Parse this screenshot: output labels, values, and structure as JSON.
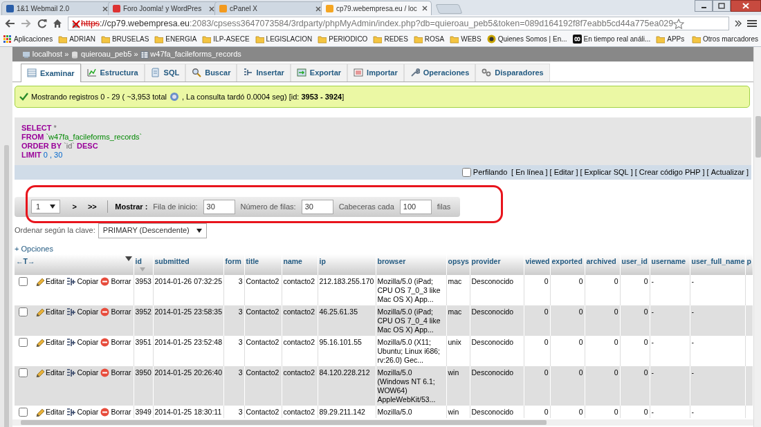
{
  "browser_tabs": [
    {
      "title": "1&1 Webmail 2.0",
      "kind": "mail",
      "selected": false
    },
    {
      "title": "Foro Joomla! y WordPres",
      "kind": "forum",
      "selected": false
    },
    {
      "title": "cPanel X",
      "kind": "cpanel",
      "selected": false
    },
    {
      "title": "cp79.webempresa.eu / loc",
      "kind": "pma",
      "selected": true
    }
  ],
  "address_bar": {
    "scheme": "https",
    "host": "://cp79.webempresa.eu",
    "path": ":2083/cpsess3647073584/3rdparty/phpMyAdmin/index.php?db=quieroau_peb5&token=089d164192f8f7eabb5cd44a775ea029"
  },
  "bookmarks": [
    {
      "label": "Aplicaciones",
      "kind": "apps"
    },
    {
      "label": "ADRIAN",
      "kind": "folder"
    },
    {
      "label": "BRUSELAS",
      "kind": "folder"
    },
    {
      "label": "ENERGIA",
      "kind": "folder"
    },
    {
      "label": "ILP-ASECE",
      "kind": "folder"
    },
    {
      "label": "LEGISLACION",
      "kind": "folder"
    },
    {
      "label": "PERIODICO",
      "kind": "folder"
    },
    {
      "label": "REDES",
      "kind": "folder"
    },
    {
      "label": "ROSA",
      "kind": "folder"
    },
    {
      "label": "WEBS",
      "kind": "folder"
    },
    {
      "label": "Quienes Somos | En...",
      "kind": "site"
    },
    {
      "label": "En tiempo real análi...",
      "kind": "infinity"
    },
    {
      "label": "APPs",
      "kind": "folder"
    }
  ],
  "other_bookmarks": "Otros marcadores",
  "breadcrumb": [
    {
      "label": "localhost",
      "kind": "server"
    },
    {
      "separator": "»",
      "label": "quieroau_peb5",
      "kind": "database"
    },
    {
      "separator": "»",
      "label": "w47fa_facileforms_records",
      "kind": "table"
    }
  ],
  "pma_tabs": [
    {
      "label": "Examinar",
      "kind": "browse",
      "selected": true
    },
    {
      "label": "Estructura",
      "kind": "structure",
      "selected": false
    },
    {
      "label": "SQL",
      "kind": "sql",
      "selected": false
    },
    {
      "label": "Buscar",
      "kind": "search",
      "selected": false
    },
    {
      "label": "Insertar",
      "kind": "insert",
      "selected": false
    },
    {
      "label": "Exportar",
      "kind": "export",
      "selected": false
    },
    {
      "label": "Importar",
      "kind": "import",
      "selected": false
    },
    {
      "label": "Operaciones",
      "kind": "operations",
      "selected": false
    },
    {
      "label": "Disparadores",
      "kind": "triggers",
      "selected": false
    }
  ],
  "message": {
    "text": "Mostrando registros 0 - 29 ( ~3,953 total",
    "detail": ", La consulta tardó 0.0004 seg) [id: **3953 - 3924**]"
  },
  "sql": [
    [
      {
        "kind": "keyword",
        "text": "SELECT"
      },
      {
        "kind": "plain",
        "text": "*"
      }
    ],
    [
      {
        "kind": "keyword",
        "text": "FROM"
      },
      {
        "kind": "table",
        "text": "`w47fa_facileforms_records`"
      }
    ],
    [
      {
        "kind": "keyword",
        "text": "ORDER BY"
      },
      {
        "kind": "plain",
        "text": "`id`"
      },
      {
        "kind": "keyword",
        "text": "DESC"
      }
    ],
    [
      {
        "kind": "keyword",
        "text": "LIMIT"
      },
      {
        "kind": "number",
        "text": "0 , 30"
      }
    ]
  ],
  "profiling": {
    "label": "Perfilando",
    "checked": false
  },
  "sql_links": [
    {
      "open": "[",
      "label": "En línea",
      "close": "]"
    },
    {
      "open": "[",
      "label": "Editar",
      "close": "]"
    },
    {
      "open": "[",
      "label": "Explicar SQL",
      "close": "]"
    },
    {
      "open": "[",
      "label": "Crear código PHP",
      "close": "]"
    },
    {
      "open": "[",
      "label": "Actualizar",
      "close": "]"
    }
  ],
  "navigation": {
    "annotated": true,
    "page": "1",
    "next": ">",
    "last": ">>",
    "show_label": "Mostrar :",
    "start_label": "Fila de inicio:",
    "start": "30",
    "rows_label": "Número de filas:",
    "rows": "30",
    "headers_label": "Cabeceras cada",
    "headers": "100",
    "rows_suffix": "filas"
  },
  "sort": {
    "label": "Ordenar según la clave:",
    "value": "PRIMARY (Descendente)"
  },
  "options_link": "+ Opciones",
  "table": {
    "arrows": "←T→",
    "columns": [
      {
        "label": "id",
        "kind": "text"
      },
      {
        "label": "submitted",
        "kind": "text"
      },
      {
        "label": "form",
        "kind": "number"
      },
      {
        "label": "title",
        "kind": "text"
      },
      {
        "label": "name",
        "kind": "text"
      },
      {
        "label": "ip",
        "kind": "text"
      },
      {
        "label": "browser",
        "kind": "long"
      },
      {
        "label": "opsys",
        "kind": "text"
      },
      {
        "label": "provider",
        "kind": "text"
      },
      {
        "label": "viewed",
        "kind": "number"
      },
      {
        "label": "exported",
        "kind": "number"
      },
      {
        "label": "archived",
        "kind": "number"
      },
      {
        "label": "user_id",
        "kind": "number"
      },
      {
        "label": "username",
        "kind": "text"
      },
      {
        "label": "user_full_name",
        "kind": "text"
      },
      {
        "label": "p",
        "kind": "text"
      }
    ],
    "rows": [
      {
        "selected": false,
        "actions": [
          {
            "kind": "edit",
            "label": "Editar"
          },
          {
            "kind": "copy",
            "label": "Copiar"
          },
          {
            "kind": "delete",
            "label": "Borrar"
          }
        ],
        "cells": [
          "3953",
          "2014-01-26 07:32:25",
          "3",
          "Contacto2",
          "contacto2",
          "212.183.255.170",
          "Mozilla/5.0 (iPad; CPU OS 7_0_3 like Mac OS X) App...",
          "mac",
          "Desconocido",
          "0",
          "0",
          "0",
          "0",
          "-",
          "-"
        ]
      },
      {
        "selected": false,
        "actions": [
          {
            "kind": "edit",
            "label": "Editar"
          },
          {
            "kind": "copy",
            "label": "Copiar"
          },
          {
            "kind": "delete",
            "label": "Borrar"
          }
        ],
        "cells": [
          "3952",
          "2014-01-25 23:58:35",
          "3",
          "Contacto2",
          "contacto2",
          "46.25.61.35",
          "Mozilla/5.0 (iPad; CPU OS 7_0_4 like Mac OS X) App...",
          "mac",
          "Desconocido",
          "0",
          "0",
          "0",
          "0",
          "-",
          "-"
        ]
      },
      {
        "selected": false,
        "actions": [
          {
            "kind": "edit",
            "label": "Editar"
          },
          {
            "kind": "copy",
            "label": "Copiar"
          },
          {
            "kind": "delete",
            "label": "Borrar"
          }
        ],
        "cells": [
          "3951",
          "2014-01-25 23:52:48",
          "3",
          "Contacto2",
          "contacto2",
          "95.16.101.55",
          "Mozilla/5.0 (X11; Ubuntu; Linux i686; rv:26.0) Gec...",
          "unix",
          "Desconocido",
          "0",
          "0",
          "0",
          "0",
          "-",
          "-"
        ]
      },
      {
        "selected": false,
        "actions": [
          {
            "kind": "edit",
            "label": "Editar"
          },
          {
            "kind": "copy",
            "label": "Copiar"
          },
          {
            "kind": "delete",
            "label": "Borrar"
          }
        ],
        "cells": [
          "3950",
          "2014-01-25 20:26:40",
          "3",
          "Contacto2",
          "contacto2",
          "84.120.228.212",
          "Mozilla/5.0 (Windows NT 6.1; WOW64) AppleWebKit/53...",
          "win",
          "Desconocido",
          "0",
          "0",
          "0",
          "0",
          "-",
          "-"
        ]
      },
      {
        "selected": false,
        "actions": [
          {
            "kind": "edit",
            "label": "Editar"
          },
          {
            "kind": "copy",
            "label": "Copiar"
          },
          {
            "kind": "delete",
            "label": "Borrar"
          }
        ],
        "cells": [
          "3949",
          "2014-01-25 18:30:11",
          "3",
          "Contacto2",
          "contacto2",
          "89.29.211.142",
          "Mozilla/5.0",
          "win",
          "Desconocido",
          "0",
          "0",
          "0",
          "0",
          "-",
          "-"
        ]
      }
    ]
  }
}
